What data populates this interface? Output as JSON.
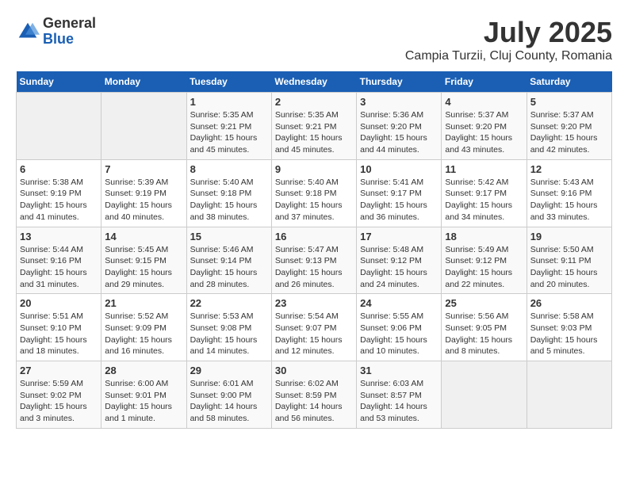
{
  "header": {
    "logo_general": "General",
    "logo_blue": "Blue",
    "month": "July 2025",
    "location": "Campia Turzii, Cluj County, Romania"
  },
  "days_of_week": [
    "Sunday",
    "Monday",
    "Tuesday",
    "Wednesday",
    "Thursday",
    "Friday",
    "Saturday"
  ],
  "weeks": [
    [
      {
        "num": "",
        "info": ""
      },
      {
        "num": "",
        "info": ""
      },
      {
        "num": "1",
        "info": "Sunrise: 5:35 AM\nSunset: 9:21 PM\nDaylight: 15 hours and 45 minutes."
      },
      {
        "num": "2",
        "info": "Sunrise: 5:35 AM\nSunset: 9:21 PM\nDaylight: 15 hours and 45 minutes."
      },
      {
        "num": "3",
        "info": "Sunrise: 5:36 AM\nSunset: 9:20 PM\nDaylight: 15 hours and 44 minutes."
      },
      {
        "num": "4",
        "info": "Sunrise: 5:37 AM\nSunset: 9:20 PM\nDaylight: 15 hours and 43 minutes."
      },
      {
        "num": "5",
        "info": "Sunrise: 5:37 AM\nSunset: 9:20 PM\nDaylight: 15 hours and 42 minutes."
      }
    ],
    [
      {
        "num": "6",
        "info": "Sunrise: 5:38 AM\nSunset: 9:19 PM\nDaylight: 15 hours and 41 minutes."
      },
      {
        "num": "7",
        "info": "Sunrise: 5:39 AM\nSunset: 9:19 PM\nDaylight: 15 hours and 40 minutes."
      },
      {
        "num": "8",
        "info": "Sunrise: 5:40 AM\nSunset: 9:18 PM\nDaylight: 15 hours and 38 minutes."
      },
      {
        "num": "9",
        "info": "Sunrise: 5:40 AM\nSunset: 9:18 PM\nDaylight: 15 hours and 37 minutes."
      },
      {
        "num": "10",
        "info": "Sunrise: 5:41 AM\nSunset: 9:17 PM\nDaylight: 15 hours and 36 minutes."
      },
      {
        "num": "11",
        "info": "Sunrise: 5:42 AM\nSunset: 9:17 PM\nDaylight: 15 hours and 34 minutes."
      },
      {
        "num": "12",
        "info": "Sunrise: 5:43 AM\nSunset: 9:16 PM\nDaylight: 15 hours and 33 minutes."
      }
    ],
    [
      {
        "num": "13",
        "info": "Sunrise: 5:44 AM\nSunset: 9:16 PM\nDaylight: 15 hours and 31 minutes."
      },
      {
        "num": "14",
        "info": "Sunrise: 5:45 AM\nSunset: 9:15 PM\nDaylight: 15 hours and 29 minutes."
      },
      {
        "num": "15",
        "info": "Sunrise: 5:46 AM\nSunset: 9:14 PM\nDaylight: 15 hours and 28 minutes."
      },
      {
        "num": "16",
        "info": "Sunrise: 5:47 AM\nSunset: 9:13 PM\nDaylight: 15 hours and 26 minutes."
      },
      {
        "num": "17",
        "info": "Sunrise: 5:48 AM\nSunset: 9:12 PM\nDaylight: 15 hours and 24 minutes."
      },
      {
        "num": "18",
        "info": "Sunrise: 5:49 AM\nSunset: 9:12 PM\nDaylight: 15 hours and 22 minutes."
      },
      {
        "num": "19",
        "info": "Sunrise: 5:50 AM\nSunset: 9:11 PM\nDaylight: 15 hours and 20 minutes."
      }
    ],
    [
      {
        "num": "20",
        "info": "Sunrise: 5:51 AM\nSunset: 9:10 PM\nDaylight: 15 hours and 18 minutes."
      },
      {
        "num": "21",
        "info": "Sunrise: 5:52 AM\nSunset: 9:09 PM\nDaylight: 15 hours and 16 minutes."
      },
      {
        "num": "22",
        "info": "Sunrise: 5:53 AM\nSunset: 9:08 PM\nDaylight: 15 hours and 14 minutes."
      },
      {
        "num": "23",
        "info": "Sunrise: 5:54 AM\nSunset: 9:07 PM\nDaylight: 15 hours and 12 minutes."
      },
      {
        "num": "24",
        "info": "Sunrise: 5:55 AM\nSunset: 9:06 PM\nDaylight: 15 hours and 10 minutes."
      },
      {
        "num": "25",
        "info": "Sunrise: 5:56 AM\nSunset: 9:05 PM\nDaylight: 15 hours and 8 minutes."
      },
      {
        "num": "26",
        "info": "Sunrise: 5:58 AM\nSunset: 9:03 PM\nDaylight: 15 hours and 5 minutes."
      }
    ],
    [
      {
        "num": "27",
        "info": "Sunrise: 5:59 AM\nSunset: 9:02 PM\nDaylight: 15 hours and 3 minutes."
      },
      {
        "num": "28",
        "info": "Sunrise: 6:00 AM\nSunset: 9:01 PM\nDaylight: 15 hours and 1 minute."
      },
      {
        "num": "29",
        "info": "Sunrise: 6:01 AM\nSunset: 9:00 PM\nDaylight: 14 hours and 58 minutes."
      },
      {
        "num": "30",
        "info": "Sunrise: 6:02 AM\nSunset: 8:59 PM\nDaylight: 14 hours and 56 minutes."
      },
      {
        "num": "31",
        "info": "Sunrise: 6:03 AM\nSunset: 8:57 PM\nDaylight: 14 hours and 53 minutes."
      },
      {
        "num": "",
        "info": ""
      },
      {
        "num": "",
        "info": ""
      }
    ]
  ]
}
